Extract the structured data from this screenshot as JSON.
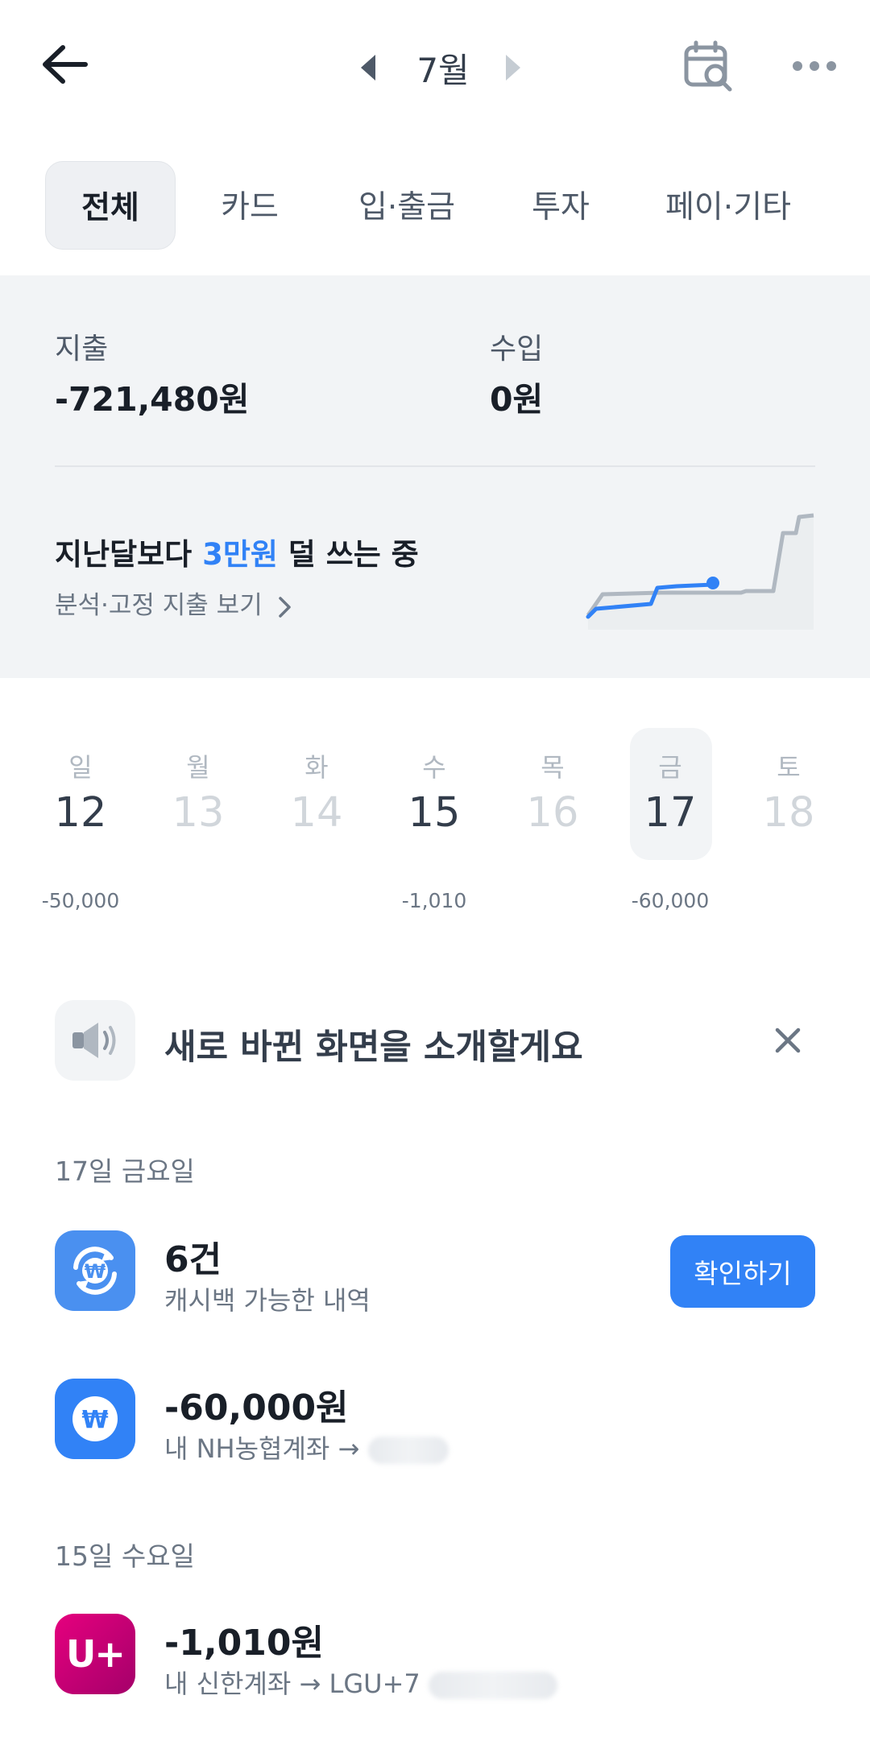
{
  "header": {
    "month": "7월"
  },
  "tabs": [
    {
      "label": "전체"
    },
    {
      "label": "카드"
    },
    {
      "label": "입·출금"
    },
    {
      "label": "투자"
    },
    {
      "label": "페이·기타"
    }
  ],
  "summary": {
    "expense_label": "지출",
    "expense_value": "-721,480원",
    "income_label": "수입",
    "income_value": "0원",
    "compare_prefix": "지난달보다 ",
    "compare_amount": "3만원",
    "compare_suffix": " 덜 쓰는 중",
    "analysis_link": "분석·고정 지출 보기"
  },
  "week": {
    "days": [
      {
        "name": "일",
        "num": "12",
        "amount": "-50,000"
      },
      {
        "name": "월",
        "num": "13",
        "amount": ""
      },
      {
        "name": "화",
        "num": "14",
        "amount": ""
      },
      {
        "name": "수",
        "num": "15",
        "amount": "-1,010"
      },
      {
        "name": "목",
        "num": "16",
        "amount": ""
      },
      {
        "name": "금",
        "num": "17",
        "amount": "-60,000"
      },
      {
        "name": "토",
        "num": "18",
        "amount": ""
      }
    ],
    "selected_index": 5
  },
  "notice": {
    "text": "새로 바뀐 화면을 소개할게요"
  },
  "sections": [
    {
      "date": "17일 금요일",
      "items": [
        {
          "title": "6건",
          "subtitle": "캐시백 가능한 내역",
          "action": "확인하기"
        },
        {
          "title": "-60,000원",
          "subtitle": "내 NH농협계좌 →"
        }
      ]
    },
    {
      "date": "15일 수요일",
      "items": [
        {
          "title": "-1,010원",
          "subtitle": "내 신한계좌 → LGU+7",
          "icon_text": "U+"
        }
      ]
    }
  ],
  "colors": {
    "accent": "#3182f6",
    "panel_bg": "#f2f4f6",
    "lgu_magenta": "#d1007b"
  }
}
